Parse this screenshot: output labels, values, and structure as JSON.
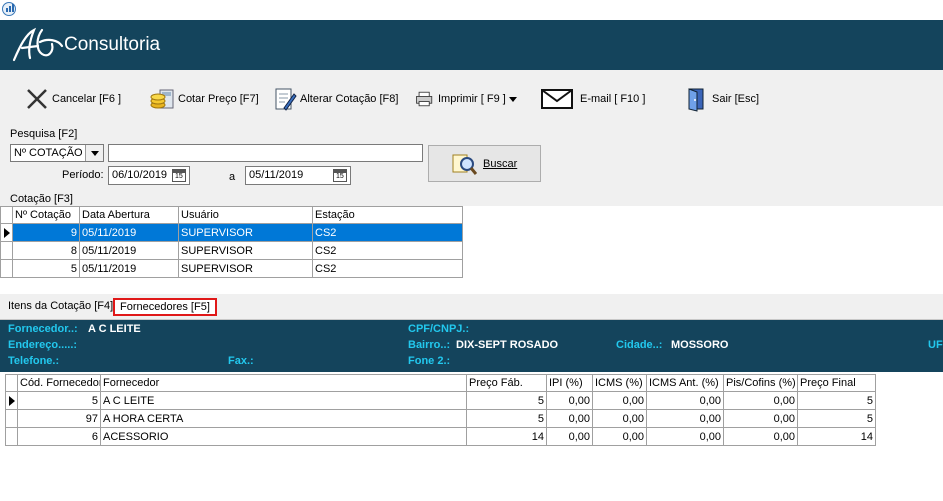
{
  "titlebar": {
    "icon": "chart-app-icon"
  },
  "banner": {
    "brand": "Consultoria",
    "logo": "logo-mark-icon"
  },
  "toolbar": {
    "cancelar": "Cancelar [F6 ]",
    "cotar": "Cotar Preço [F7]",
    "alterar": "Alterar Cotação [F8]",
    "imprimir": "Imprimir [ F9 ]",
    "email": "E-mail  [ F10 ]",
    "sair": "Sair  [Esc]"
  },
  "search": {
    "label": "Pesquisa [F2]",
    "field_value": "Nº COTAÇÃO",
    "text_value": "",
    "periodo_label": "Período:",
    "date_from": "06/10/2019",
    "a_label": "a",
    "date_to": "05/11/2019",
    "cal_icon_text": "15",
    "buscar_label": "Buscar"
  },
  "cotacao": {
    "label": "Cotação [F3]",
    "columns": [
      "Nº Cotação",
      "Data Abertura",
      "Usuário",
      "Estação"
    ],
    "rows": [
      {
        "num": "9",
        "data": "05/11/2019",
        "usuario": "SUPERVISOR",
        "estacao": "CS2",
        "selected": true
      },
      {
        "num": "8",
        "data": "05/11/2019",
        "usuario": "SUPERVISOR",
        "estacao": "CS2"
      },
      {
        "num": "5",
        "data": "05/11/2019",
        "usuario": "SUPERVISOR",
        "estacao": "CS2"
      }
    ]
  },
  "tabs": {
    "itens": "Itens da Cotação [F4]",
    "fornecedores": "Fornecedores [F5]"
  },
  "fornecedor_panel": {
    "fornecedor_label": "Fornecedor..:",
    "fornecedor_value": "A C LEITE",
    "endereco_label": "Endereço.....:",
    "telefone_label": "Telefone.:",
    "fax_label": "Fax.:",
    "cpf_label": "CPF/CNPJ.:",
    "bairro_label": "Bairro..:",
    "bairro_value": "DIX-SEPT ROSADO",
    "cidade_label": "Cidade..:",
    "cidade_value": "MOSSORO",
    "fone2_label": "Fone 2.:",
    "uf_label": "UF"
  },
  "fornecedores": {
    "columns": [
      "Cód. Fornecedor",
      "Fornecedor",
      "Preço Fáb.",
      "IPI (%)",
      "ICMS (%)",
      "ICMS Ant. (%)",
      "Pis/Cofins (%)",
      "Preço Final"
    ],
    "rows": [
      {
        "cod": "5",
        "nome": "A C LEITE",
        "preco": "5",
        "ipi": "0,00",
        "icms": "0,00",
        "icms_ant": "0,00",
        "pis": "0,00",
        "final": "5"
      },
      {
        "cod": "97",
        "nome": "A HORA CERTA",
        "preco": "5",
        "ipi": "0,00",
        "icms": "0,00",
        "icms_ant": "0,00",
        "pis": "0,00",
        "final": "5"
      },
      {
        "cod": "6",
        "nome": "ACESSORIO",
        "preco": "14",
        "ipi": "0,00",
        "icms": "0,00",
        "icms_ant": "0,00",
        "pis": "0,00",
        "final": "14"
      }
    ]
  }
}
